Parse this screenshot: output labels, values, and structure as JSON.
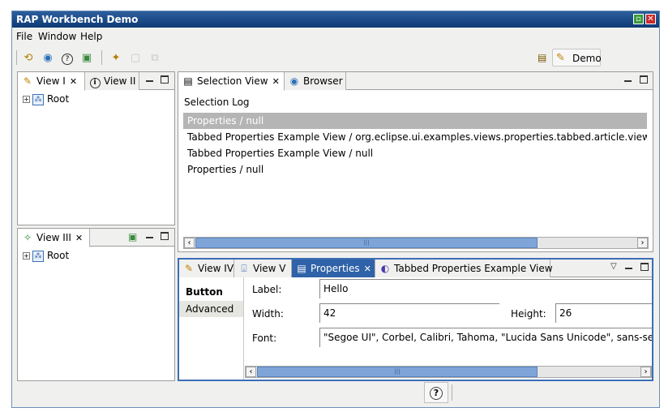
{
  "window": {
    "title": "RAP Workbench Demo"
  },
  "menu": [
    "File",
    "Window",
    "Help"
  ],
  "perspective": {
    "label": "Demo"
  },
  "view1": {
    "tabs": [
      {
        "label": "View I"
      },
      {
        "label": "View II"
      }
    ],
    "tree": [
      {
        "label": "Root"
      }
    ]
  },
  "view3": {
    "tabs": [
      {
        "label": "View III"
      }
    ],
    "tree": [
      {
        "label": "Root"
      }
    ]
  },
  "selection_view": {
    "tabs": [
      {
        "label": "Selection View"
      },
      {
        "label": "Browser"
      }
    ],
    "heading": "Selection Log",
    "log": [
      "Properties / null",
      "Tabbed Properties Example View / org.eclipse.ui.examples.views.properties.tabbed.article.views.Bu",
      "Tabbed Properties Example View / null",
      "Properties / null"
    ]
  },
  "bottom_view": {
    "tabs": [
      {
        "label": "View IV"
      },
      {
        "label": "View V"
      },
      {
        "label": "Properties"
      },
      {
        "label": "Tabbed Properties Example View"
      }
    ],
    "sections": [
      "Button",
      "Advanced"
    ],
    "fields": {
      "label_label": "Label:",
      "label_value": "Hello",
      "width_label": "Width:",
      "width_value": "42",
      "height_label": "Height:",
      "height_value": "26",
      "font_label": "Font:",
      "font_value": "\"Segoe UI\", Corbel, Calibri, Tahoma, \"Lucida Sans Unicode\", sans-serif-m"
    }
  },
  "icons": {
    "help": "?",
    "close_x": "✕"
  },
  "colors": {
    "title_bar": "#1e4d8a",
    "active_tab": "#2f62a8",
    "selection_row": "#b5b5b5",
    "scroll_thumb": "#7fa5d8"
  }
}
